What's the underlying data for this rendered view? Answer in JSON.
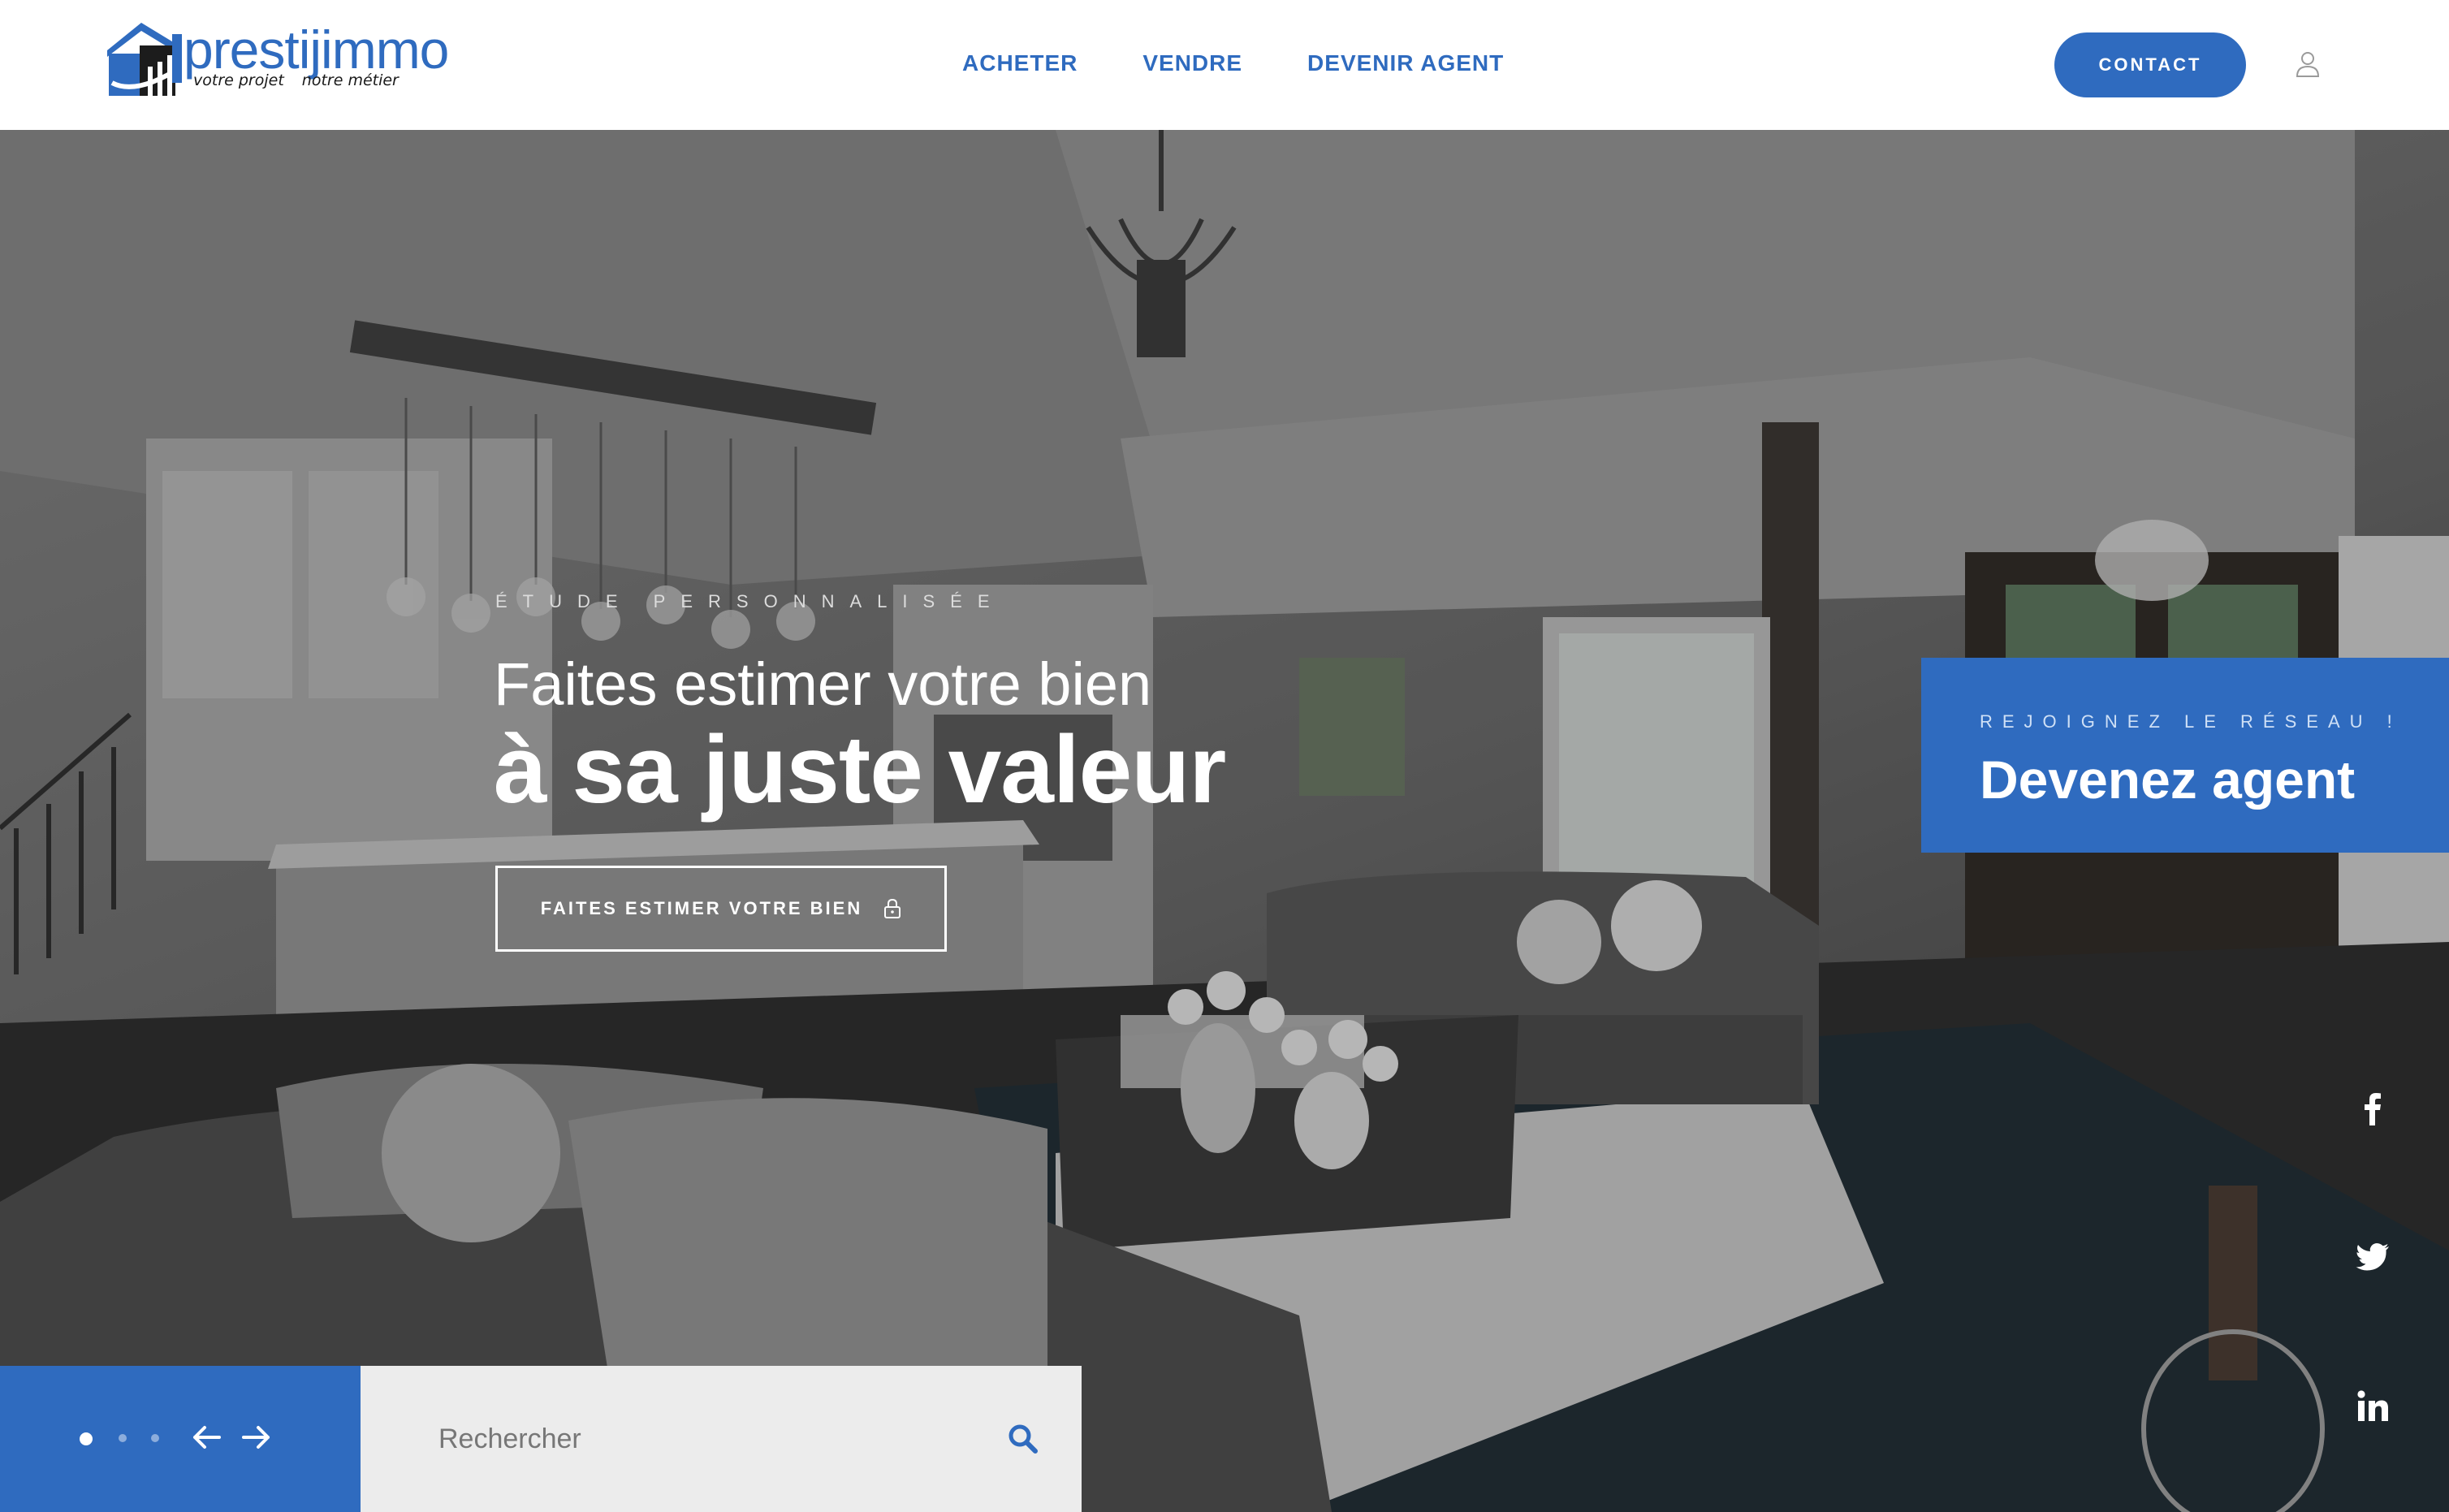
{
  "brand": {
    "name": "prestijimmo",
    "tagline_left": "votre projet",
    "tagline_right": "notre métier",
    "accent": "#2f6bbf"
  },
  "nav": {
    "items": [
      {
        "label": "ACHETER"
      },
      {
        "label": "VENDRE"
      },
      {
        "label": "DEVENIR AGENT"
      }
    ],
    "contact_label": "CONTACT",
    "user_icon": "user-icon"
  },
  "hero": {
    "eyebrow": "ÉTUDE PERSONNALISÉE",
    "headline_line1": "Faites estimer votre bien",
    "headline_line2": "à sa juste valeur",
    "cta_label": "FAITES ESTIMER VOTRE BIEN",
    "cta_icon": "lock-icon"
  },
  "agent_panel": {
    "eyebrow": "REJOIGNEZ LE RÉSEAU !",
    "title": "Devenez agent",
    "background": "#2f6bbf"
  },
  "social": {
    "icons": [
      "facebook-icon",
      "twitter-icon",
      "linkedin-icon"
    ]
  },
  "slider": {
    "slide_count": 3,
    "active_slide": 1,
    "prev_icon": "arrow-left-icon",
    "next_icon": "arrow-right-icon"
  },
  "search": {
    "placeholder": "Rechercher",
    "icon": "search-icon"
  }
}
